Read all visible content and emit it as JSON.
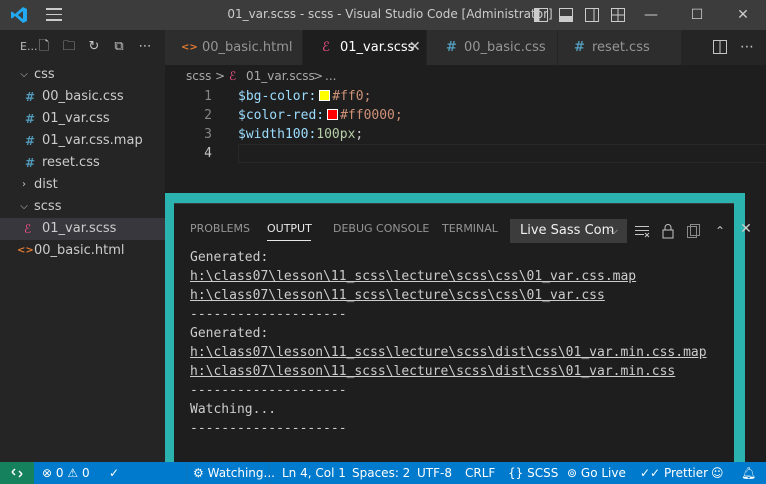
{
  "window": {
    "title": "01_var.scss - scss - Visual Studio Code [Administrator]",
    "minimize": "—",
    "maximize": "☐",
    "close": "✕"
  },
  "sidebar": {
    "title": "E...",
    "tree": [
      {
        "label": "css",
        "type": "folder",
        "expanded": true
      },
      {
        "label": "00_basic.css",
        "type": "css"
      },
      {
        "label": "01_var.css",
        "type": "css"
      },
      {
        "label": "01_var.css.map",
        "type": "css"
      },
      {
        "label": "reset.css",
        "type": "css"
      },
      {
        "label": "dist",
        "type": "folder",
        "expanded": false
      },
      {
        "label": "scss",
        "type": "folder",
        "expanded": true
      },
      {
        "label": "01_var.scss",
        "type": "scss",
        "selected": true
      },
      {
        "label": "00_basic.html",
        "type": "html"
      }
    ]
  },
  "tabs": [
    {
      "label": "00_basic.html",
      "icon": "html-icon",
      "icon_glyph": "<>"
    },
    {
      "label": "01_var.scss",
      "icon": "sass-icon",
      "icon_glyph": "ℰ",
      "active": true,
      "close": "✕"
    },
    {
      "label": "00_basic.css",
      "icon": "css-icon",
      "icon_glyph": "#"
    },
    {
      "label": "reset.css",
      "icon": "css-icon",
      "icon_glyph": "#"
    }
  ],
  "breadcrumb": {
    "folder": "scss",
    "sep": ">",
    "file": "01_var.scss",
    "more": "..."
  },
  "editor": {
    "lines": [
      {
        "number": "1",
        "var": "$bg-color:",
        "swatch": "#ffff00",
        "value": "#ff0;"
      },
      {
        "number": "2",
        "var": "$color-red:",
        "swatch": "#ff0000",
        "value": "#ff0000;"
      },
      {
        "number": "3",
        "var": "$width100:",
        "number_value": "100px",
        "tail": ";"
      },
      {
        "number": "4"
      }
    ]
  },
  "panel": {
    "tabs": [
      "PROBLEMS",
      "OUTPUT",
      "DEBUG CONSOLE",
      "TERMINAL"
    ],
    "active_tab": "OUTPUT",
    "output_channel": "Live Sass Com",
    "output": [
      {
        "text": "Generated:",
        "link": false
      },
      {
        "text": "h:\\class07\\lesson\\11_scss\\lecture\\scss\\css\\01_var.css.map",
        "link": true
      },
      {
        "text": "h:\\class07\\lesson\\11_scss\\lecture\\scss\\css\\01_var.css",
        "link": true
      },
      {
        "text": "--------------------",
        "link": false
      },
      {
        "text": "Generated:",
        "link": false
      },
      {
        "text": "h:\\class07\\lesson\\11_scss\\lecture\\scss\\dist\\css\\01_var.min.css.map",
        "link": true
      },
      {
        "text": "h:\\class07\\lesson\\11_scss\\lecture\\scss\\dist\\css\\01_var.min.css",
        "link": true
      },
      {
        "text": "--------------------",
        "link": false
      },
      {
        "text": "Watching...",
        "link": false
      },
      {
        "text": "--------------------",
        "link": false
      }
    ]
  },
  "statusbar": {
    "errors": "0",
    "warnings": "0",
    "watching": "Watching...",
    "position": "Ln 4, Col 1",
    "spaces": "Spaces: 2",
    "encoding": "UTF-8",
    "eol": "CRLF",
    "language": "SCSS",
    "golive": "Go Live",
    "prettier": "Prettier"
  },
  "colors": {
    "accent": "#007acc",
    "panel_highlight": "#2bb3b0",
    "remote": "#16825d",
    "css_icon": "#519aba",
    "sass_icon": "#f55385",
    "html_icon": "#e37933"
  }
}
